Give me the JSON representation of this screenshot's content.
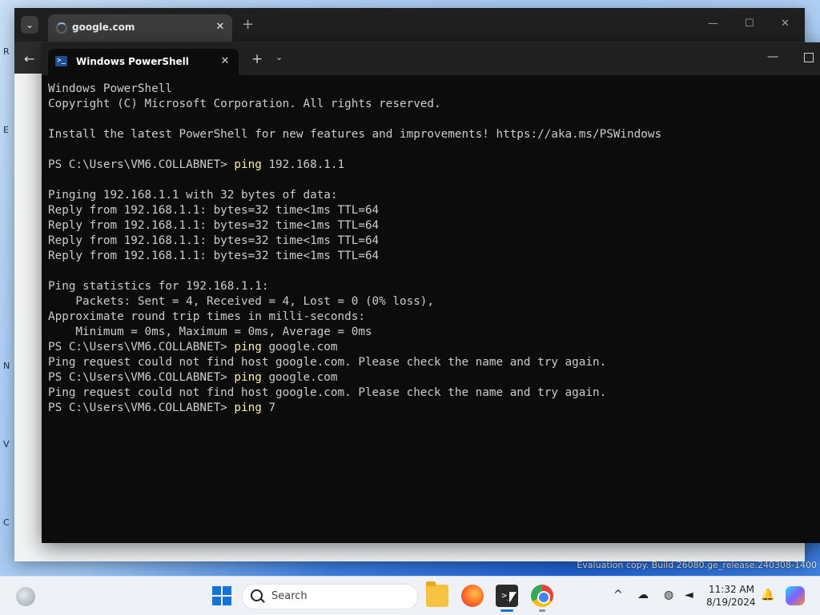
{
  "desktop": {
    "fragments": [
      "R",
      "E",
      "N",
      "V",
      "C"
    ],
    "evaluation_text": "Evaluation copy. Build 26080.ge_release.240308-1400"
  },
  "browser": {
    "tab_title": "google.com",
    "tab_close": "✕",
    "new_tab": "+",
    "dropdown": "⌄",
    "back": "←",
    "minimize": "—",
    "maximize": "☐",
    "close": "✕"
  },
  "terminal": {
    "tab_title": "Windows PowerShell",
    "tab_close": "✕",
    "new_tab": "+",
    "dropdown": "⌄",
    "minimize": "—",
    "lines": [
      {
        "text": "Windows PowerShell"
      },
      {
        "text": "Copyright (C) Microsoft Corporation. All rights reserved."
      },
      {
        "text": ""
      },
      {
        "text": "Install the latest PowerShell for new features and improvements! https://aka.ms/PSWindows"
      },
      {
        "text": ""
      },
      {
        "prompt": "PS C:\\Users\\VM6.COLLABNET> ",
        "cmd": "ping",
        "args": " 192.168.1.1"
      },
      {
        "text": ""
      },
      {
        "text": "Pinging 192.168.1.1 with 32 bytes of data:"
      },
      {
        "text": "Reply from 192.168.1.1: bytes=32 time<1ms TTL=64"
      },
      {
        "text": "Reply from 192.168.1.1: bytes=32 time<1ms TTL=64"
      },
      {
        "text": "Reply from 192.168.1.1: bytes=32 time<1ms TTL=64"
      },
      {
        "text": "Reply from 192.168.1.1: bytes=32 time<1ms TTL=64"
      },
      {
        "text": ""
      },
      {
        "text": "Ping statistics for 192.168.1.1:"
      },
      {
        "text": "    Packets: Sent = 4, Received = 4, Lost = 0 (0% loss),"
      },
      {
        "text": "Approximate round trip times in milli-seconds:"
      },
      {
        "text": "    Minimum = 0ms, Maximum = 0ms, Average = 0ms"
      },
      {
        "prompt": "PS C:\\Users\\VM6.COLLABNET> ",
        "cmd": "ping",
        "args": " google.com"
      },
      {
        "text": "Ping request could not find host google.com. Please check the name and try again."
      },
      {
        "prompt": "PS C:\\Users\\VM6.COLLABNET> ",
        "cmd": "ping",
        "args": " google.com"
      },
      {
        "text": "Ping request could not find host google.com. Please check the name and try again."
      },
      {
        "prompt": "PS C:\\Users\\VM6.COLLABNET> ",
        "cmd": "ping",
        "args": " 7"
      }
    ]
  },
  "taskbar": {
    "search_placeholder": "Search",
    "apps": [
      "file-explorer",
      "firefox",
      "terminal",
      "chrome"
    ],
    "tray": {
      "chevron": "^",
      "time": "11:32 AM",
      "date": "8/19/2024"
    }
  },
  "colors": {
    "terminal_bg": "#0c0c0c",
    "terminal_text": "#cccccc",
    "command_yellow": "#f9f1a5",
    "accent": "#1573d6"
  }
}
